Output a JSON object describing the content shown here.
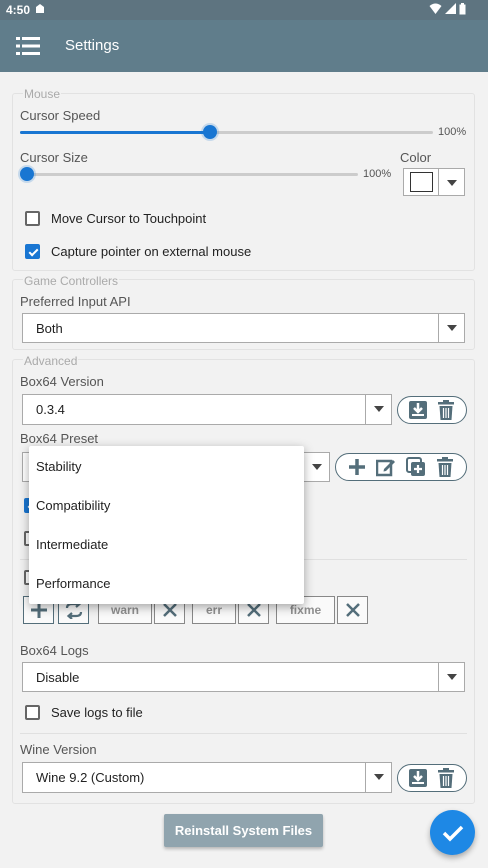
{
  "status_bar": {
    "time": "4:50"
  },
  "app_bar": {
    "title": "Settings"
  },
  "mouse": {
    "legend": "Mouse",
    "cursor_speed_label": "Cursor Speed",
    "cursor_speed_value": "100%",
    "cursor_speed_fraction": 0.46,
    "cursor_size_label": "Cursor Size",
    "cursor_size_value": "100%",
    "cursor_size_fraction": 0.0,
    "color_label": "Color",
    "color_value": "#ffffff",
    "move_cursor_label": "Move Cursor to Touchpoint",
    "move_cursor_checked": false,
    "capture_pointer_label": "Capture pointer on external mouse",
    "capture_pointer_checked": true
  },
  "game_controllers": {
    "legend": "Game Controllers",
    "preferred_api_label": "Preferred Input API",
    "preferred_api_value": "Both"
  },
  "advanced": {
    "legend": "Advanced",
    "box64_version_label": "Box64 Version",
    "box64_version_value": "0.3.4",
    "box64_preset_label": "Box64 Preset",
    "preset_options": [
      "Stability",
      "Compatibility",
      "Intermediate",
      "Performance"
    ],
    "log_tags": [
      "warn",
      "err",
      "fixme"
    ],
    "box64_logs_label": "Box64 Logs",
    "box64_logs_value": "Disable",
    "save_logs_label": "Save logs to file",
    "save_logs_checked": false,
    "wine_version_label": "Wine Version",
    "wine_version_value": "Wine 9.2 (Custom)"
  },
  "actions": {
    "reinstall_label": "Reinstall System Files"
  },
  "colors": {
    "appbar": "#607d8b",
    "accent": "#1976d2",
    "fab": "#1e88e5",
    "icon": "#546e7a"
  }
}
